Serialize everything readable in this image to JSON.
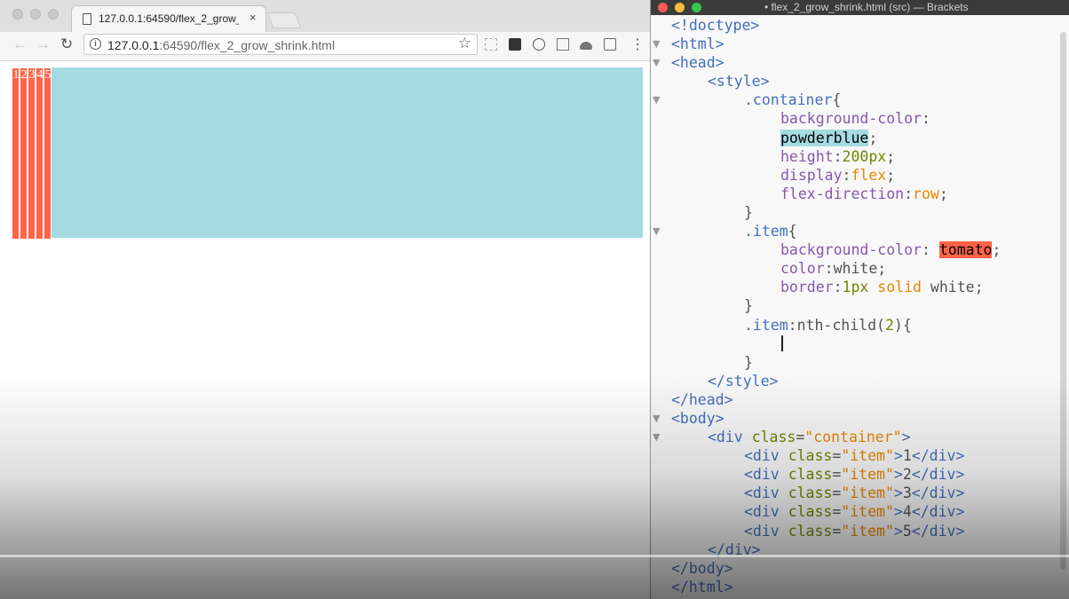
{
  "browser": {
    "tab_title": "127.0.0.1:64590/flex_2_grow_shrink.html",
    "tab_close": "×",
    "url_host": "127.0.0.1",
    "url_rest": ":64590/flex_2_grow_shrink.html",
    "nav_back": "←",
    "nav_forward": "→",
    "nav_reload": "↻",
    "bookmark_star": "☆",
    "menu": "⋮",
    "items": [
      "1",
      "2",
      "3",
      "4",
      "5"
    ],
    "colors": {
      "container": "#a4dbe3",
      "item": "#ff6347"
    }
  },
  "editor": {
    "title": "• flex_2_grow_shrink.html (src) — Brackets",
    "lines": [
      "<!doctype>",
      "<html>",
      "<head>",
      "<style>",
      ".container{",
      "background-color:",
      "powderblue;",
      "height:200px;",
      "display:flex;",
      "flex-direction:row;",
      "}",
      ".item{",
      "background-color: tomato;",
      "color:white;",
      "border:1px solid white;",
      "}",
      ".item:nth-child(2){",
      "",
      "}",
      "</style>",
      "</head>",
      "<body>",
      "<div class=\"container\">",
      "<div class=\"item\">1</div>",
      "<div class=\"item\">2</div>",
      "<div class=\"item\">3</div>",
      "<div class=\"item\">4</div>",
      "<div class=\"item\">5</div>",
      "</div>",
      "</body>",
      "</html>"
    ]
  }
}
